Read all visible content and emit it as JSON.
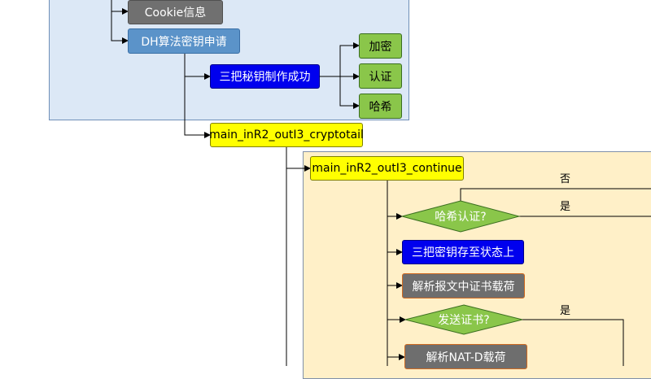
{
  "nodes": {
    "cookie": "Cookie信息",
    "dh_request": "DH算法密钥申请",
    "three_keys_made": "三把秘钥制作成功",
    "encrypt": "加密",
    "authenticate": "认证",
    "hash": "哈希",
    "cryptotail": "main_inR2_outI3_cryptotail",
    "continue": "main_inR2_outI3_continue",
    "hash_auth_q": "哈希认证?",
    "store_keys": "三把密钥存至状态上",
    "parse_cert": "解析报文中证书载荷",
    "send_cert_q": "发送证书?",
    "parse_natd": "解析NAT-D载荷"
  },
  "edge_labels": {
    "no": "否",
    "yes1": "是",
    "yes2": "是"
  },
  "colors": {
    "region_blue": "#dce8f6",
    "region_tan": "#fff0c8",
    "gray_node": "#707070",
    "steel_node": "#5b93c9",
    "blue_node": "#0000ee",
    "green_node": "#8ac64a",
    "yellow_node": "#ffff00"
  }
}
